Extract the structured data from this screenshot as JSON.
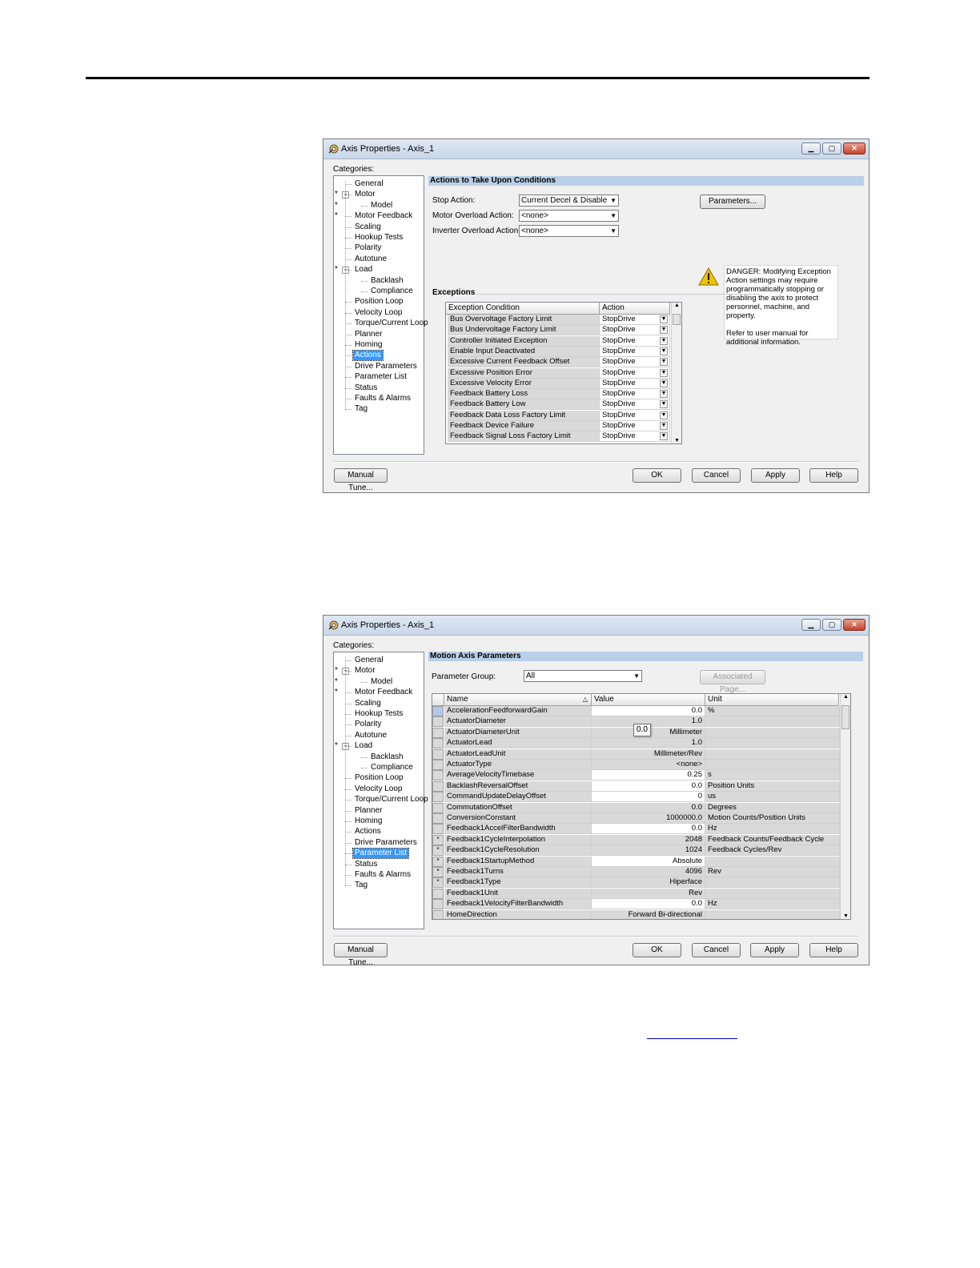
{
  "colors": {
    "accent_header": "#b9cfe8",
    "selection": "#3399ff",
    "close_button": "#c7412a"
  },
  "window1": {
    "title": "Axis Properties - Axis_1",
    "categories_label": "Categories:",
    "tree": [
      {
        "label": "General",
        "starred": false
      },
      {
        "label": "Motor",
        "starred": true
      },
      {
        "label": "Model",
        "starred": true
      },
      {
        "label": "Motor Feedback",
        "starred": true
      },
      {
        "label": "Scaling",
        "starred": false
      },
      {
        "label": "Hookup Tests",
        "starred": false
      },
      {
        "label": "Polarity",
        "starred": false
      },
      {
        "label": "Autotune",
        "starred": false
      },
      {
        "label": "Load",
        "starred": true
      },
      {
        "label": "Backlash",
        "starred": false
      },
      {
        "label": "Compliance",
        "starred": false
      },
      {
        "label": "Position Loop",
        "starred": false
      },
      {
        "label": "Velocity Loop",
        "starred": false
      },
      {
        "label": "Torque/Current Loop",
        "starred": false
      },
      {
        "label": "Planner",
        "starred": false
      },
      {
        "label": "Homing",
        "starred": false
      },
      {
        "label": "Actions",
        "starred": false,
        "selected": true
      },
      {
        "label": "Drive Parameters",
        "starred": false
      },
      {
        "label": "Parameter List",
        "starred": false
      },
      {
        "label": "Status",
        "starred": false
      },
      {
        "label": "Faults & Alarms",
        "starred": false
      },
      {
        "label": "Tag",
        "starred": false
      }
    ],
    "section_header": "Actions to Take Upon Conditions",
    "stop_action": {
      "label": "Stop Action:",
      "value": "Current Decel & Disable"
    },
    "motor_overload": {
      "label": "Motor Overload Action:",
      "value": "<none>"
    },
    "inverter_overload": {
      "label": "Inverter Overload Action:",
      "value": "<none>"
    },
    "parameters_button": "Parameters...",
    "danger_text": "DANGER: Modifying Exception Action settings may require programmatically stopping or disabling the axis to protect personnel, machine, and property.",
    "danger_refer": "Refer to user manual for additional information.",
    "exceptions_label": "Exceptions",
    "exceptions_columns": [
      "Exception Condition",
      "Action"
    ],
    "exceptions": [
      {
        "condition": "Bus Overvoltage Factory Limit",
        "action": "StopDrive"
      },
      {
        "condition": "Bus Undervoltage Factory Limit",
        "action": "StopDrive"
      },
      {
        "condition": "Controller Initiated Exception",
        "action": "StopDrive"
      },
      {
        "condition": "Enable Input Deactivated",
        "action": "StopDrive"
      },
      {
        "condition": "Excessive Current Feedback Offset",
        "action": "StopDrive"
      },
      {
        "condition": "Excessive Position Error",
        "action": "StopDrive"
      },
      {
        "condition": "Excessive Velocity Error",
        "action": "StopDrive"
      },
      {
        "condition": "Feedback Battery Loss",
        "action": "StopDrive"
      },
      {
        "condition": "Feedback Battery Low",
        "action": "StopDrive"
      },
      {
        "condition": "Feedback Data Loss Factory Limit",
        "action": "StopDrive"
      },
      {
        "condition": "Feedback Device Failure",
        "action": "StopDrive"
      },
      {
        "condition": "Feedback Signal Loss Factory Limit",
        "action": "StopDrive"
      }
    ],
    "buttons": {
      "manual_tune": "Manual Tune...",
      "ok": "OK",
      "cancel": "Cancel",
      "apply": "Apply",
      "help": "Help"
    }
  },
  "window2": {
    "title": "Axis Properties - Axis_1",
    "categories_label": "Categories:",
    "section_header": "Motion Axis Parameters",
    "parameter_group": {
      "label": "Parameter Group:",
      "value": "All"
    },
    "associated_page_button": "Associated Page...",
    "columns": [
      "Name",
      "Value",
      "Unit"
    ],
    "tooltip": "0.0",
    "params": [
      {
        "marker": "",
        "name": "AccelerationFeedforwardGain",
        "value": "0.0",
        "unit": "%",
        "editable": true
      },
      {
        "marker": "",
        "name": "ActuatorDiameter",
        "value": "1.0",
        "unit": "",
        "editable": false
      },
      {
        "marker": "",
        "name": "ActuatorDiameterUnit",
        "value": "Millimeter",
        "unit": "",
        "editable": false
      },
      {
        "marker": "",
        "name": "ActuatorLead",
        "value": "1.0",
        "unit": "",
        "editable": false
      },
      {
        "marker": "",
        "name": "ActuatorLeadUnit",
        "value": "Millimeter/Rev",
        "unit": "",
        "editable": false
      },
      {
        "marker": "",
        "name": "ActuatorType",
        "value": "<none>",
        "unit": "",
        "editable": false
      },
      {
        "marker": "",
        "name": "AverageVelocityTimebase",
        "value": "0.25",
        "unit": "s",
        "editable": true
      },
      {
        "marker": "",
        "name": "BacklashReversalOffset",
        "value": "0.0",
        "unit": "Position Units",
        "editable": true
      },
      {
        "marker": "",
        "name": "CommandUpdateDelayOffset",
        "value": "0",
        "unit": "us",
        "editable": true
      },
      {
        "marker": "",
        "name": "CommutationOffset",
        "value": "0.0",
        "unit": "Degrees",
        "editable": false
      },
      {
        "marker": "",
        "name": "ConversionConstant",
        "value": "1000000.0",
        "unit": "Motion Counts/Position Units",
        "editable": false
      },
      {
        "marker": "",
        "name": "Feedback1AccelFilterBandwidth",
        "value": "0.0",
        "unit": "Hz",
        "editable": true
      },
      {
        "marker": "*",
        "name": "Feedback1CycleInterpolation",
        "value": "2048",
        "unit": "Feedback Counts/Feedback Cycle",
        "editable": false
      },
      {
        "marker": "*",
        "name": "Feedback1CycleResolution",
        "value": "1024",
        "unit": "Feedback Cycles/Rev",
        "editable": false
      },
      {
        "marker": "*",
        "name": "Feedback1StartupMethod",
        "value": "Absolute",
        "unit": "",
        "editable": true
      },
      {
        "marker": "*",
        "name": "Feedback1Turns",
        "value": "4096",
        "unit": "Rev",
        "editable": false
      },
      {
        "marker": "*",
        "name": "Feedback1Type",
        "value": "Hiperface",
        "unit": "",
        "editable": false
      },
      {
        "marker": "",
        "name": "Feedback1Unit",
        "value": "Rev",
        "unit": "",
        "editable": false
      },
      {
        "marker": "",
        "name": "Feedback1VelocityFilterBandwidth",
        "value": "0.0",
        "unit": "Hz",
        "editable": true
      },
      {
        "marker": "",
        "name": "HomeDirection",
        "value": "Forward Bi-directional",
        "unit": "",
        "editable": false
      }
    ],
    "buttons": {
      "manual_tune": "Manual Tune...",
      "ok": "OK",
      "cancel": "Cancel",
      "apply": "Apply",
      "help": "Help"
    }
  }
}
